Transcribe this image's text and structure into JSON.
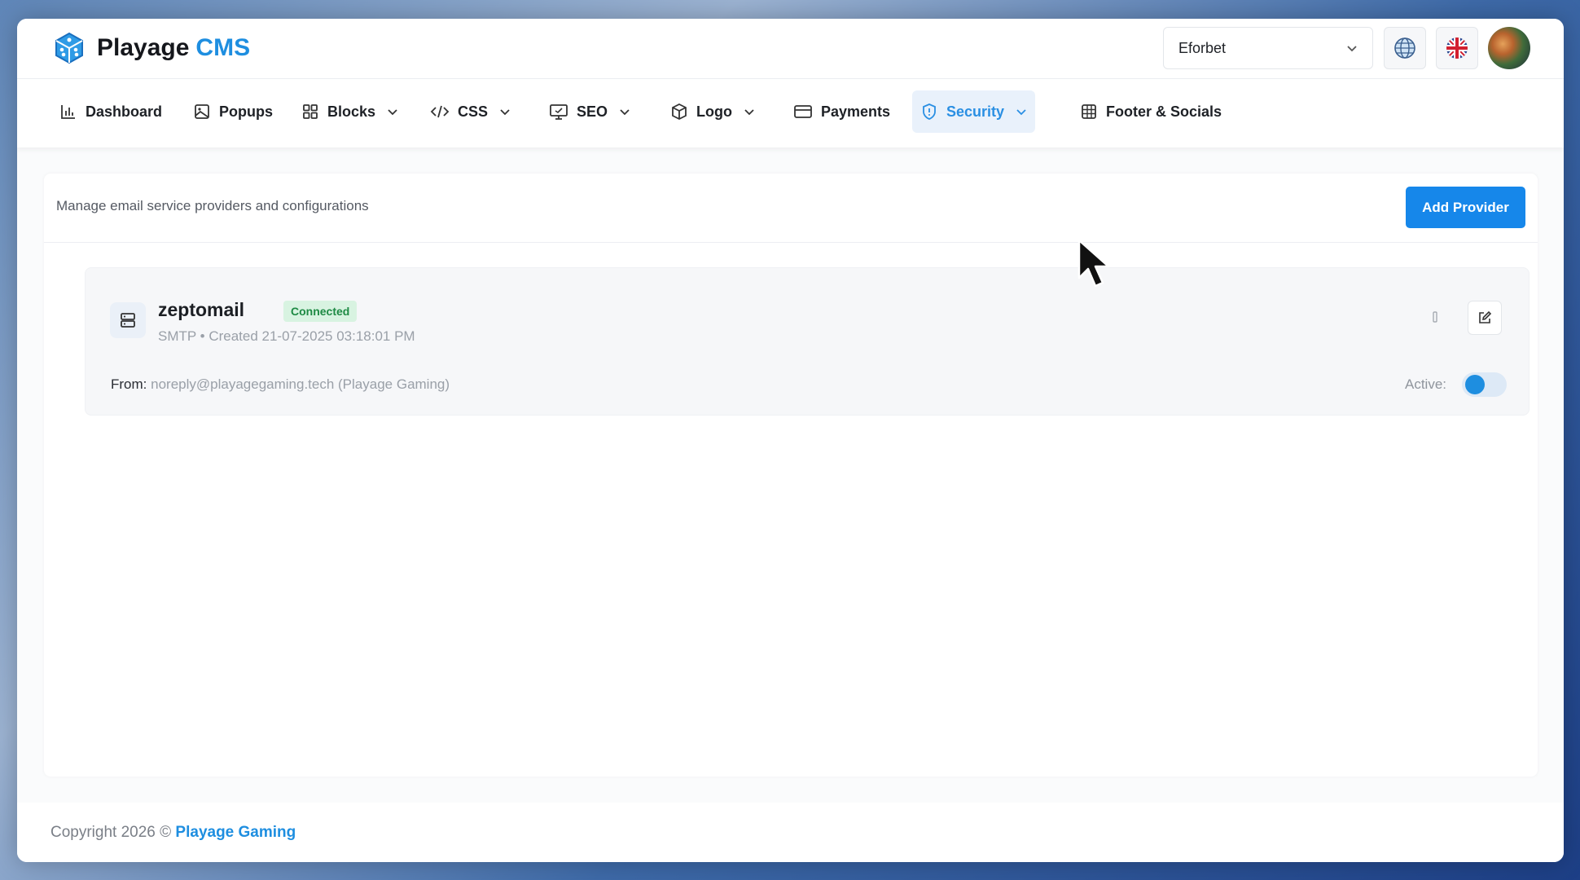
{
  "app": {
    "title_main": "Playage",
    "title_accent": "CMS"
  },
  "header": {
    "site_select_value": "Eforbet",
    "icons": [
      "chevron-down-icon",
      "globe-icon",
      "uk-flag-icon",
      "avatar"
    ]
  },
  "nav": {
    "items": [
      {
        "label": "Dashboard",
        "icon": "bar-chart-icon",
        "dropdown": false
      },
      {
        "label": "Popups",
        "icon": "image-icon",
        "dropdown": false
      },
      {
        "label": "Blocks",
        "icon": "grid-icon",
        "dropdown": true
      },
      {
        "label": "CSS",
        "icon": "code-icon",
        "dropdown": true
      },
      {
        "label": "SEO",
        "icon": "monitor-icon",
        "dropdown": true
      },
      {
        "label": "Logo",
        "icon": "box-icon",
        "dropdown": true
      },
      {
        "label": "Payments",
        "icon": "credit-card-icon",
        "dropdown": false
      },
      {
        "label": "Security",
        "icon": "shield-icon",
        "dropdown": true,
        "active": true
      },
      {
        "label": "Footer & Socials",
        "icon": "table-icon",
        "dropdown": false
      }
    ]
  },
  "main": {
    "description": "Manage email service providers and configurations",
    "add_button_label": "Add Provider",
    "providers": [
      {
        "name": "zeptomail",
        "status": "Connected",
        "meta": "SMTP • Created 21-07-2025 03:18:01 PM",
        "from_label": "From:",
        "from_value": "noreply@playagegaming.tech (Playage Gaming)",
        "active_label": "Active:",
        "active": true
      }
    ]
  },
  "footer": {
    "copyright": "Copyright 2026 ©",
    "company": "Playage Gaming"
  },
  "colors": {
    "accent": "#1e8ee0",
    "button": "#1687ea",
    "badge_bg": "#d8f3e1",
    "badge_text": "#1e8a44"
  }
}
